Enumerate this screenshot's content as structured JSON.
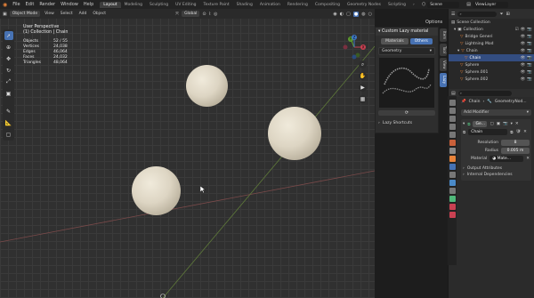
{
  "topbar": {
    "menus": [
      "File",
      "Edit",
      "Render",
      "Window",
      "Help"
    ],
    "workspaces": [
      "Layout",
      "Modeling",
      "Sculpting",
      "UV Editing",
      "Texture Paint",
      "Shading",
      "Animation",
      "Rendering",
      "Compositing",
      "Geometry Nodes",
      "Scripting"
    ],
    "active_workspace": "Layout",
    "scene": "Scene",
    "view_layer": "ViewLayer"
  },
  "viewport_header": {
    "mode": "Object Mode",
    "menus": [
      "View",
      "Select",
      "Add",
      "Object"
    ],
    "transform": "Global",
    "options": "Options"
  },
  "overlay": {
    "view_name": "User Perspective",
    "collection": "(1) Collection | Chain",
    "stats": [
      {
        "label": "Objects",
        "value": "52 / 55"
      },
      {
        "label": "Vertices",
        "value": "24,038"
      },
      {
        "label": "Edges",
        "value": "46,064"
      },
      {
        "label": "Faces",
        "value": "24,032"
      },
      {
        "label": "Triangles",
        "value": "48,064"
      }
    ]
  },
  "gizmo": {
    "x": "X",
    "y": "Y",
    "z": "Z"
  },
  "npanel": {
    "title": "Custom Lazy material",
    "tabs": [
      "Materials",
      "Others"
    ],
    "active_tab": "Others",
    "dropdown": "Geometry",
    "shortcuts": "Lazy Shortcuts",
    "side_tabs": [
      "Item",
      "Tool",
      "View",
      "Lazy"
    ]
  },
  "outliner": {
    "root": "Scene Collection",
    "items": [
      {
        "label": "Collection",
        "indent": 1
      },
      {
        "label": "Bridge Generi",
        "indent": 2
      },
      {
        "label": "Lightning Mod",
        "indent": 2
      },
      {
        "label": "Chain",
        "indent": 2
      },
      {
        "label": "Chain",
        "indent": 3,
        "selected": true
      },
      {
        "label": "Sphere",
        "indent": 2
      },
      {
        "label": "Sphere.001",
        "indent": 2
      },
      {
        "label": "Sphere.002",
        "indent": 2
      }
    ]
  },
  "properties": {
    "breadcrumb_obj": "Chain",
    "breadcrumb_mod": "GeometryNod...",
    "add_modifier": "Add Modifier",
    "modifier_name": "Ge...",
    "node_group": "Chain",
    "fields": [
      {
        "label": "Resolution",
        "value": "8"
      },
      {
        "label": "Radius",
        "value": "0.005 m"
      },
      {
        "label": "Material",
        "value": "Mate..."
      }
    ],
    "sections": [
      "Output Attributes",
      "Internal Dependencies"
    ]
  },
  "colors": {
    "accent": "#4772b3",
    "selected_row": "#334d80",
    "sphere": "#ddd5c3",
    "orange_object": "#e8833a"
  }
}
